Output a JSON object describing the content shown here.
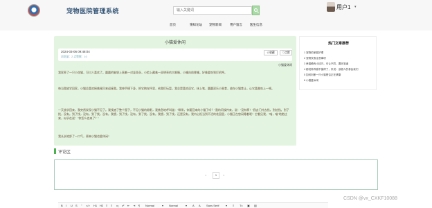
{
  "header": {
    "site_title": "宠物医院管理系统",
    "search_placeholder": "输入关键词",
    "user_name": "用户1",
    "user_caret": "▾"
  },
  "nav": [
    "首页",
    "猜知论坛",
    "宠物新闻",
    "用户留言",
    "医生信息"
  ],
  "article": {
    "title": "小猫爱休闲",
    "date": "2024-03-06 09:48:04",
    "stats": "浏览量：2    点赞数：10",
    "fav_label": "☆收藏",
    "like_label": "♡点赞",
    "author": "小猫爱休闲",
    "paragraphs": [
      "我家养了一只小花猫，可讨人喜欢了。圆圆的脑袋上直着一对竖耳朵，小脸上藏着一双明亮的大眼睛，小嘴向前厚嘴，好像要吃到打招呼。",
      "每当我放学回家，小猫总喜欢摇着尾巴来迎接我。我伸手摸下身，把它抱在怀里，给我们玩耍。我总是喜欢逗它，抹上笔，圆圆双乐小乘食，放在小猫食让，让它喜美吃上一顿。",
      "一天放学回来，我突然发现小猫不见了。我找遍了整个屋子，不见小猫的踪影，我焦急地呼叫道：\"咪咪，你要回来的小猫了吗？\"我的问候传来，说：\"没有啊！\"我去门外去找，到处找。到了找，没有。到了找，没有。到了找，没有。我想，到了找，没有。到了找，没有。我想，到了找，还是没有。我内心担当到不活的花园里，小猫正在悠闲睡着呢！它看见我，\"喵，喵\"地跑过来，似乎在说：\"你怎么也来了？\"",
      "我长长地舒了一口气，原来小猫也爱休闲！"
    ]
  },
  "sidebar": {
    "title": "热门文章推荐",
    "items": [
      "1  宠物的家庭护理",
      "2  宠物饮食注意事项",
      "3  养猫确有小技巧，可让不同，要好准道",
      "4  都说养养猫不值得了，来说：该超人的参会我们",
      "5  如何判断一只小猫是否正在健康",
      "6  小猫爱休闲"
    ]
  },
  "comments": {
    "label": "评论区",
    "prev": "<",
    "page": "1",
    "next": ">"
  },
  "editor": {
    "tools": [
      "B",
      "I",
      "U",
      "S",
      "\"",
      "</>",
      "H1",
      "H2",
      "≡",
      "≡",
      "x₂",
      "x²",
      "⇤",
      "⇥",
      "¶",
      "Normal",
      "▾",
      "Normal",
      "▾",
      "A",
      "A",
      "Sans Serif",
      "▾",
      "≡",
      "Tx",
      "▣",
      "▤"
    ]
  },
  "watermark": "CSDN @vx_CXKF10088"
}
